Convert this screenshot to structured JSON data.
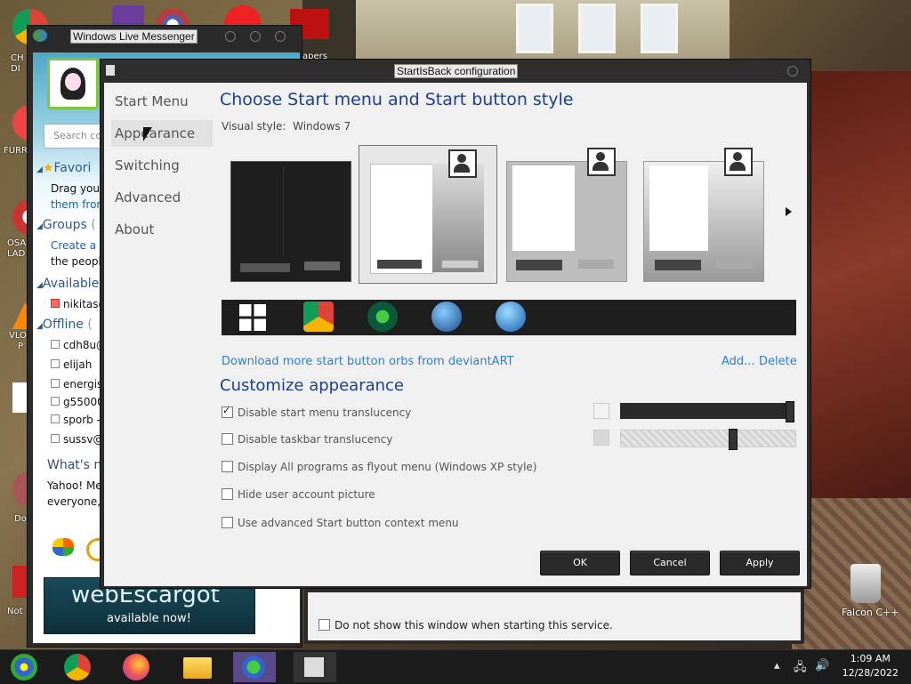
{
  "desktop": {
    "labels": [
      "CH",
      "DI",
      "FURR",
      "OSA",
      "LAD",
      "VLO",
      "P",
      "Do",
      "Not",
      "apers"
    ],
    "falcon_label": "Falcon C++"
  },
  "messenger": {
    "title": "Windows Live Messenger",
    "search_placeholder": "Search co",
    "favorites_header": "Favori",
    "favorites_line1": "Drag your",
    "favorites_line2": "them from",
    "groups_header": "Groups",
    "groups_count": "(",
    "groups_line1": "Create a ",
    "groups_line2": "the people",
    "available_header": "Available",
    "available_contacts": [
      "nikitas@"
    ],
    "offline_header": "Offline",
    "offline_count": "(",
    "offline_contacts": [
      "cdh8u@",
      "elijah",
      "energist",
      "g55000",
      "sporb - ",
      "sussv@"
    ],
    "whats_new": "What's n",
    "yahoo_line1": "Yahoo! Mes",
    "yahoo_line2": "everyone, g",
    "banner_big": "webEscargot",
    "banner_small": "available now!"
  },
  "dialog": {
    "title": "StartIsBack configuration",
    "nav": [
      "Start Menu",
      "Appearance",
      "Switching",
      "Advanced",
      "About"
    ],
    "selected_nav": "Appearance",
    "heading_style": "Choose Start menu and Start button style",
    "visual_style_label": "Visual style:",
    "visual_style_value": "Windows 7",
    "download_link": "Download more start button orbs from deviantART",
    "add_link": "Add...",
    "delete_link": "Delete",
    "heading_customize": "Customize appearance",
    "options": [
      {
        "label": "Disable start menu translucency",
        "checked": true
      },
      {
        "label": "Disable taskbar translucency",
        "checked": false
      },
      {
        "label": "Display All programs as flyout menu (Windows XP style)",
        "checked": false
      },
      {
        "label": "Hide user account picture",
        "checked": false
      },
      {
        "label": "Use advanced Start button context menu",
        "checked": false
      }
    ],
    "start_menu_translucency_level": 1.0,
    "taskbar_translucency_level": 0.65,
    "ok_label": "OK",
    "cancel_label": "Cancel",
    "apply_label": "Apply"
  },
  "service_window": {
    "checkbox_label": "Do not show this window when starting this service."
  },
  "taskbar": {
    "icons": [
      "escargot-icon",
      "chrome-icon",
      "firefox-icon",
      "explorer-icon",
      "messenger-icon",
      "startisback-icon"
    ],
    "time": "1:09 AM",
    "date": "12/28/2022"
  }
}
